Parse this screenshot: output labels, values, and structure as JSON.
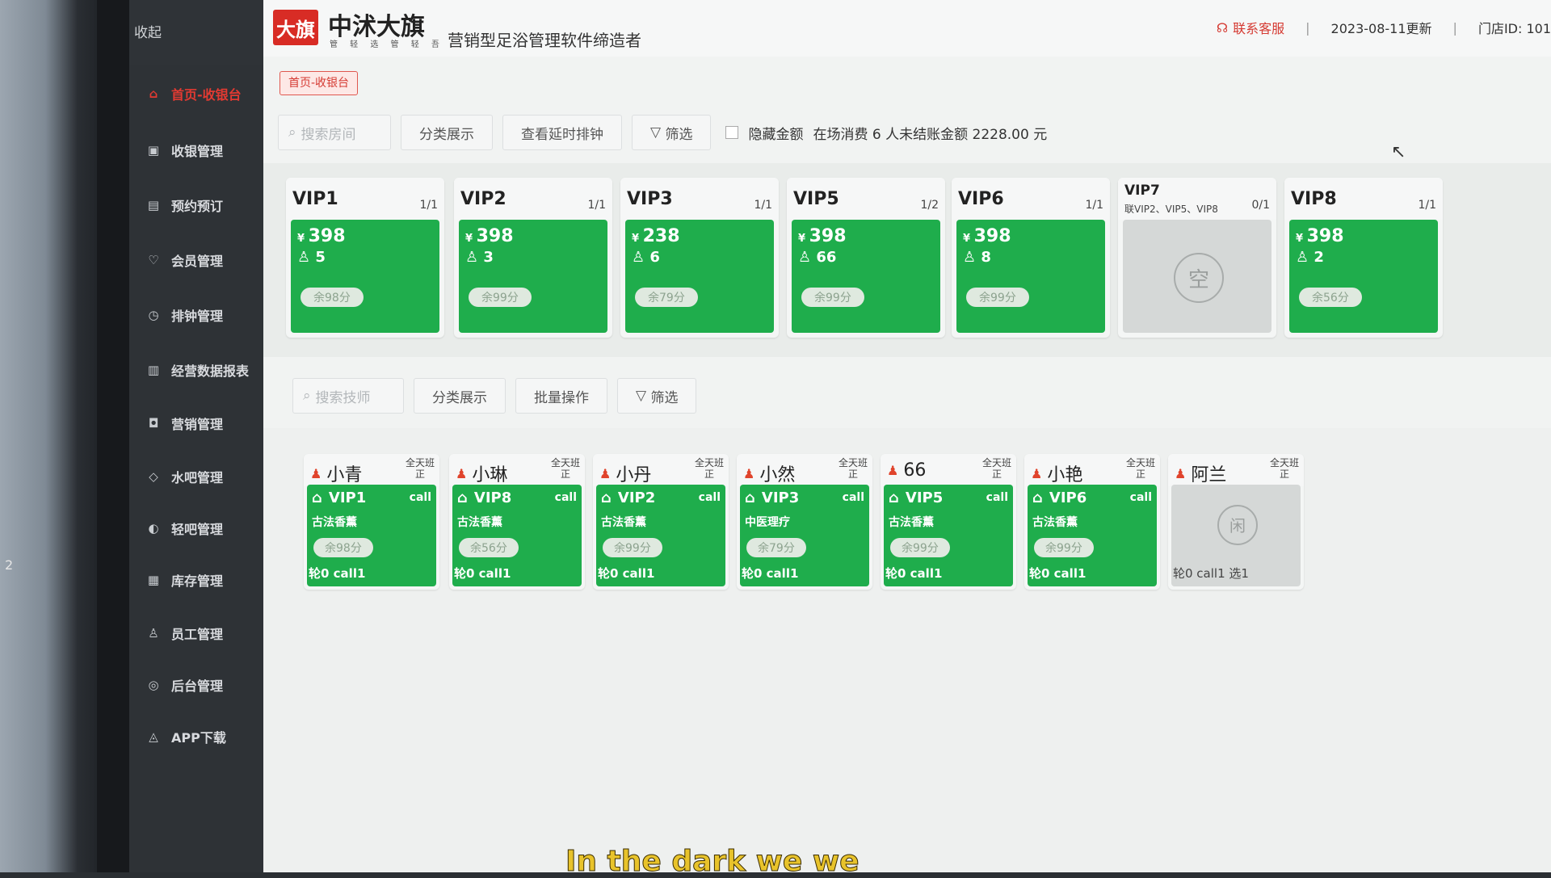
{
  "bezel": {
    "tag": "2"
  },
  "sidebar": {
    "collapse_label": "收起",
    "collapse_icon": "«",
    "items": [
      {
        "label": "首页-收银台",
        "icon": "⌂",
        "active": true
      },
      {
        "label": "收银管理",
        "icon": "▣"
      },
      {
        "label": "预约预订",
        "icon": "▤"
      },
      {
        "label": "会员管理",
        "icon": "♡"
      },
      {
        "label": "排钟管理",
        "icon": "◷"
      },
      {
        "label": "经营数据报表",
        "icon": "▥"
      },
      {
        "label": "营销管理",
        "icon": "◘"
      },
      {
        "label": "水吧管理",
        "icon": "◇"
      },
      {
        "label": "轻吧管理",
        "icon": "◐"
      },
      {
        "label": "库存管理",
        "icon": "▦"
      },
      {
        "label": "员工管理",
        "icon": "♙"
      },
      {
        "label": "后台管理",
        "icon": "◎"
      },
      {
        "label": "APP下载",
        "icon": "◬"
      }
    ]
  },
  "header": {
    "logo_mark": "大旗",
    "logo_text": "中沭大旗",
    "logo_sub": "管 轻 选  管 轻 吾",
    "slogan": "营销型足浴管理软件缔造者",
    "contact": "联系客服",
    "updated": "2023-08-11更新",
    "store_id": "门店ID: 101"
  },
  "breadcrumb": "首页-收银台",
  "toolbar": {
    "search_placeholder": "搜索房间",
    "category": "分类展示",
    "overtime": "查看延时排钟",
    "filter": "筛选",
    "hide_amount": "隐藏金额",
    "summary": "在场消费 6 人未结账金额 2228.00 元"
  },
  "rooms": [
    {
      "name": "VIP1",
      "cap": "1/1",
      "price": "398",
      "people": "5",
      "remain": "余98分"
    },
    {
      "name": "VIP2",
      "cap": "1/1",
      "price": "398",
      "people": "3",
      "remain": "余99分"
    },
    {
      "name": "VIP3",
      "cap": "1/1",
      "price": "238",
      "people": "6",
      "remain": "余79分"
    },
    {
      "name": "VIP5",
      "cap": "1/2",
      "price": "398",
      "people": "66",
      "remain": "余99分"
    },
    {
      "name": "VIP6",
      "cap": "1/1",
      "price": "398",
      "people": "8",
      "remain": "余99分"
    },
    {
      "name": "VIP7",
      "sub": "联VIP2、VIP5、VIP8",
      "cap": "0/1",
      "empty": true,
      "empty_label": "空"
    },
    {
      "name": "VIP8",
      "cap": "1/1",
      "price": "398",
      "people": "2",
      "remain": "余56分"
    }
  ],
  "toolbar2": {
    "search_placeholder": "搜索技师",
    "category": "分类展示",
    "batch": "批量操作",
    "filter": "筛选"
  },
  "staff": [
    {
      "name": "小青",
      "shift": "全天班",
      "tag": "正",
      "room": "VIP1",
      "call": "call",
      "service": "古法香薰",
      "remain": "余98分",
      "foot": "轮0 call1"
    },
    {
      "name": "小琳",
      "shift": "全天班",
      "tag": "正",
      "room": "VIP8",
      "call": "call",
      "service": "古法香薰",
      "remain": "余56分",
      "foot": "轮0 call1"
    },
    {
      "name": "小丹",
      "shift": "全天班",
      "tag": "正",
      "room": "VIP2",
      "call": "call",
      "service": "古法香薰",
      "remain": "余99分",
      "foot": "轮0 call1"
    },
    {
      "name": "小然",
      "shift": "全天班",
      "tag": "正",
      "room": "VIP3",
      "call": "call",
      "service": "中医理疗",
      "remain": "余79分",
      "foot": "轮0 call1"
    },
    {
      "name": "66",
      "shift": "全天班",
      "tag": "正",
      "room": "VIP5",
      "call": "call",
      "service": "古法香薰",
      "remain": "余99分",
      "foot": "轮0 call1"
    },
    {
      "name": "小艳",
      "shift": "全天班",
      "tag": "正",
      "room": "VIP6",
      "call": "call",
      "service": "古法香薰",
      "remain": "余99分",
      "foot": "轮0 call1"
    },
    {
      "name": "阿兰",
      "shift": "全天班",
      "tag": "正",
      "idle": true,
      "idle_label": "闲",
      "foot": "轮0 call1 选1"
    }
  ],
  "subtitle": "In the dark we we",
  "colors": {
    "accent": "#d82c25",
    "busy": "#1fad4c",
    "idle": "#d5d8d7",
    "sidebar": "#2e3236"
  }
}
